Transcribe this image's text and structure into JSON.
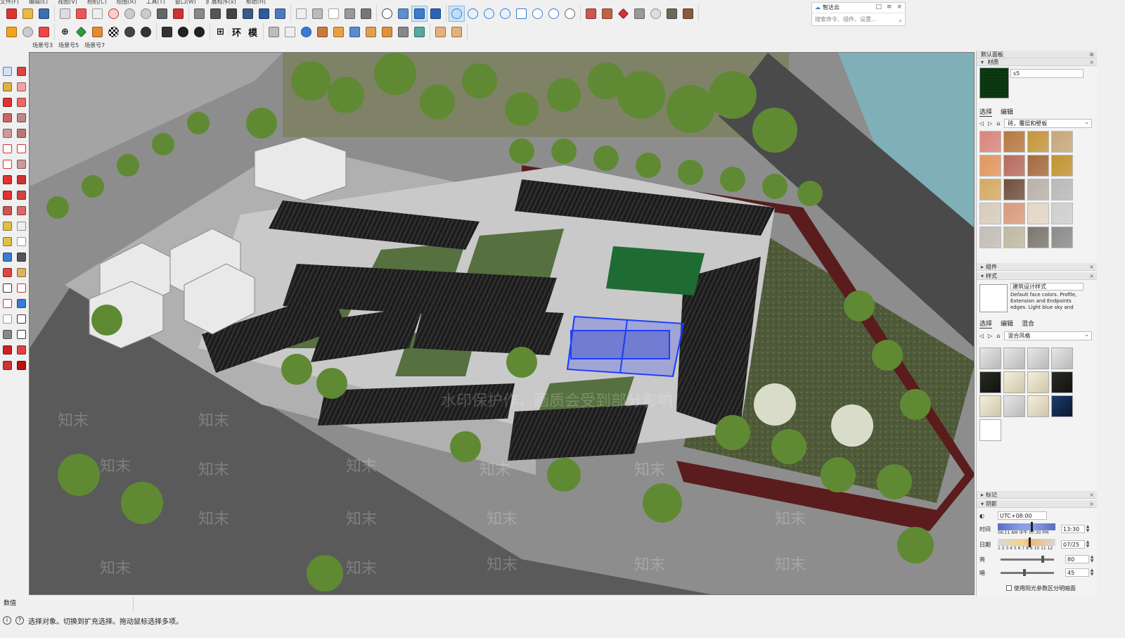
{
  "menubar": {
    "items": [
      "文件(F)",
      "编辑(E)",
      "视图(V)",
      "相机(C)",
      "绘图(R)",
      "工具(T)",
      "窗口(W)",
      "扩展程序(x)",
      "帮助(H)"
    ]
  },
  "scene_tabs": [
    "场景号3",
    "场景号5",
    "场景号7"
  ],
  "search": {
    "title": "智达云",
    "placeholder": "搜索命令、插件、设置...",
    "controls": [
      "□",
      "≡",
      "×"
    ]
  },
  "tray": {
    "title": "默认面板",
    "materials": {
      "header": "材质",
      "name": "s5",
      "tab_select": "选择",
      "tab_edit": "编辑",
      "collection": "砖，覆层和壁板",
      "swatch_color": "#0c3a12",
      "swatches": [
        "#d9847a",
        "#b7773f",
        "#c59437",
        "#c6a778",
        "#e2955d",
        "#b76b5d",
        "#a6693c",
        "#c2932f",
        "#d6a95f",
        "#6f4f3a",
        "#b8b2a8",
        "#b9b9b9",
        "#d7ccbc",
        "#d89a7d",
        "#e3d7c3",
        "#cfcfcf",
        "#c2bdb5",
        "#bfb9a0",
        "#7b766d",
        "#8a8a88"
      ]
    },
    "components": {
      "header": "组件"
    },
    "styles": {
      "header": "样式",
      "name": "建筑设计样式",
      "description": "Default face colors. Profile, Extension and Endpoints edges. Light blue sky and",
      "tab_select": "选择",
      "tab_edit": "编辑",
      "tab_mix": "混合",
      "collection": "混合风格"
    },
    "tags": {
      "header": "标记"
    },
    "shadows": {
      "header": "阴影",
      "timezone": "UTC+08:00",
      "time_label": "时间",
      "time_start": "06:11 AM",
      "time_mid": "中午",
      "time_end": "07:30 PM",
      "time_value": "13:30",
      "time_fraction": 0.6,
      "date_label": "日期",
      "date_ticks": "1 2 3 4 5 6 7 8 9 10 11 12",
      "date_value": "07/25",
      "date_fraction": 0.56,
      "light_label": "亮",
      "light_value": "80",
      "light_fraction": 0.8,
      "dark_label": "暗",
      "dark_value": "45",
      "dark_fraction": 0.45,
      "checkbox_label": "使用阳光参数区分明暗面"
    }
  },
  "viewport": {
    "watermark_notice": "水印保护作，画质会受到部分影响",
    "watermark_brand": "知末"
  },
  "vcb_label": "数值",
  "status": {
    "text": "选择对象。切换到扩充选择。拖动鼠标选择多项。"
  }
}
